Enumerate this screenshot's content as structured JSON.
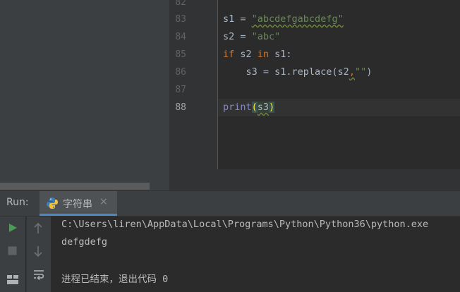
{
  "editor": {
    "partial_line_number": "82",
    "lines": [
      {
        "number": "83",
        "var": "s1",
        "op": " = ",
        "str": "\"abcdefgabcdefg\""
      },
      {
        "number": "84",
        "var": "s2",
        "op": " = ",
        "str": "\"abc\""
      },
      {
        "number": "85",
        "kw_if": "if",
        "cond_a": " s2 ",
        "kw_in": "in",
        "cond_b": " s1:"
      },
      {
        "number": "86",
        "indent": "    ",
        "assign": "s3 = s1.replace(s2",
        "comma": ",",
        "str": "\"\"",
        "close": ")"
      },
      {
        "number": "87"
      },
      {
        "number": "88",
        "func": "print",
        "open": "(",
        "arg": "s3",
        "close": ")"
      }
    ]
  },
  "run_panel": {
    "label": "Run:",
    "tab_title": "字符串",
    "tab_close": "×"
  },
  "console": {
    "path_line": "C:\\Users\\liren\\AppData\\Local\\Programs\\Python\\Python36\\python.exe",
    "output": "defgdefg",
    "exit_message": "进程已结束，退出代码 0"
  },
  "colors": {
    "run_icon": "#499c54",
    "stop_icon": "#5f6263",
    "tab_underline": "#4a88c7"
  },
  "icons": [
    "python-icon",
    "run-icon",
    "stop-icon",
    "arrow-up-icon",
    "arrow-down-icon",
    "soft-wrap-icon",
    "layout-icon"
  ]
}
